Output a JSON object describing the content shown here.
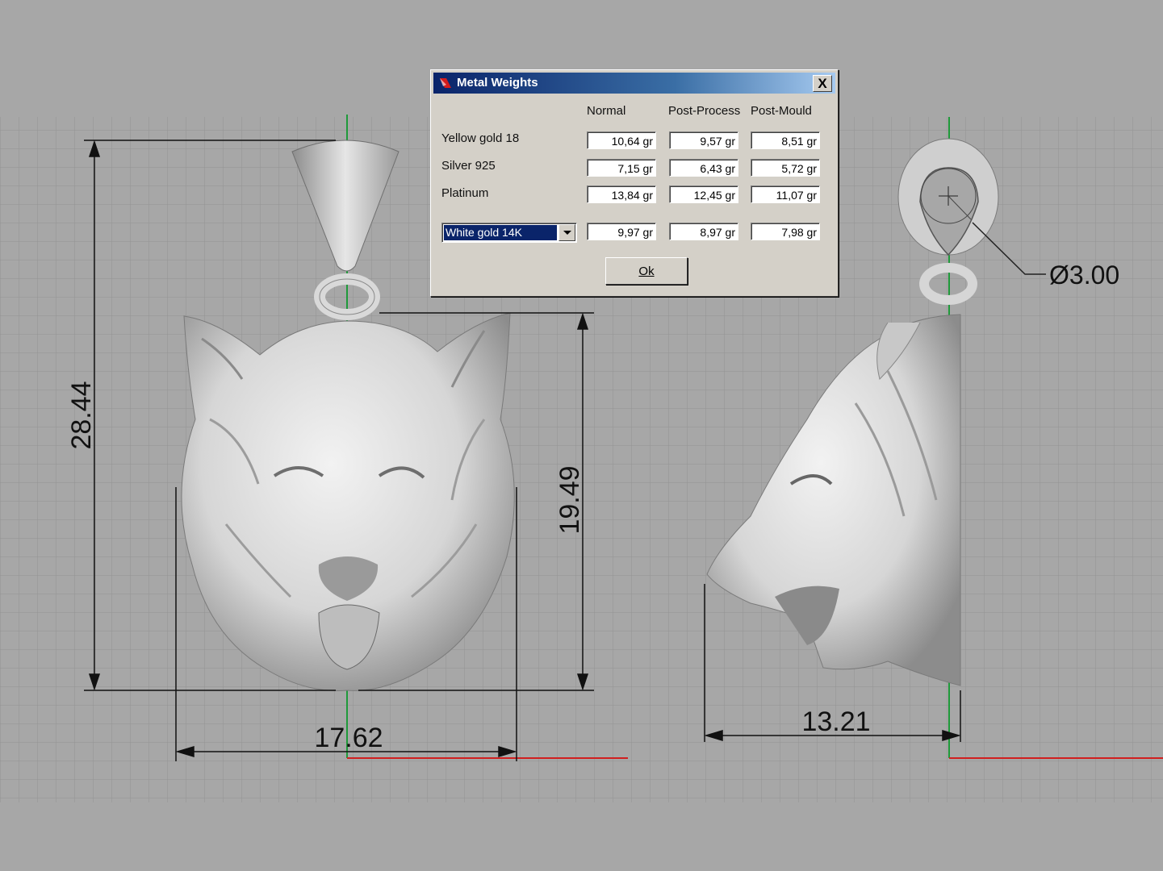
{
  "viewport": {
    "dimensions": {
      "front_height": "28.44",
      "front_head_height": "19.49",
      "front_width": "17.62",
      "side_width": "13.21",
      "bail_diameter": "Ø3.00"
    }
  },
  "dialog": {
    "title": "Metal Weights",
    "close_label": "X",
    "columns": [
      "Normal",
      "Post-Process",
      "Post-Mould"
    ],
    "rows": [
      {
        "metal": "Yellow gold 18",
        "values": [
          "10,64 gr",
          "9,57 gr",
          "8,51 gr"
        ]
      },
      {
        "metal": "Silver 925",
        "values": [
          "7,15 gr",
          "6,43 gr",
          "5,72 gr"
        ]
      },
      {
        "metal": "Platinum",
        "values": [
          "13,84 gr",
          "12,45 gr",
          "11,07 gr"
        ]
      }
    ],
    "select": {
      "value": "White gold 14K",
      "values": [
        "9,97 gr",
        "8,97 gr",
        "7,98 gr"
      ]
    },
    "ok_label": "Ok"
  },
  "colors": {
    "background": "#a7a7a7",
    "grid": "#8f8f8f",
    "axis_x": "#d11f1f",
    "axis_y": "#1f9a3a",
    "titlebar_start": "#0a246a"
  }
}
